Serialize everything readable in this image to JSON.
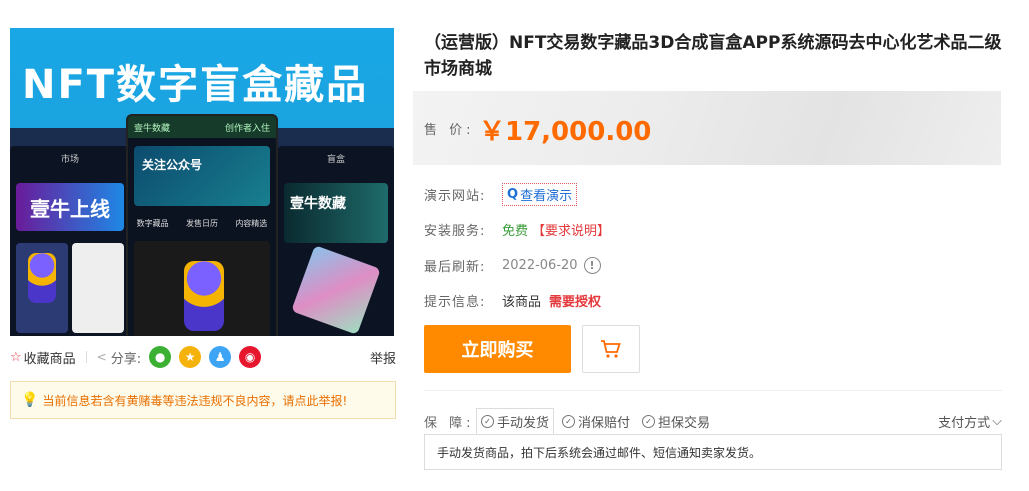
{
  "image": {
    "banner_title": "NFT数字盲盒藏品",
    "left_tab": "市场",
    "left_neon": "壹牛上线",
    "mid_brand": "壹牛数藏",
    "mid_creator": "创作者入住",
    "mid_follow": "关注公众号",
    "mid_tabs": [
      "数字藏品",
      "发售日历",
      "内容精选"
    ],
    "right_tab": "盲盒",
    "right_banner": "壹牛数藏"
  },
  "actions": {
    "favorite_label": "收藏商品",
    "share_label": "分享:",
    "report_label": "举报"
  },
  "notice": {
    "text": "当前信息若含有黄赌毒等违法违规不良内容，请点此举报!"
  },
  "product": {
    "title": "（运营版）NFT交易数字藏品3D合成盲盒APP系统源码去中心化艺术品二级市场商城",
    "price_label": "售 价:",
    "price": "￥17,000.00"
  },
  "info": {
    "demo_label": "演示网站:",
    "demo_link": "查看演示",
    "service_label": "安装服务:",
    "service_value": "免费",
    "service_note": "【要求说明】",
    "refresh_label": "最后刷新:",
    "refresh_value": "2022-06-20",
    "tip_label": "提示信息:",
    "tip_value": "该商品",
    "tip_flag": "需要授权"
  },
  "buttons": {
    "buy": "立即购买"
  },
  "guarantee": {
    "label": "保 障:",
    "items": [
      "手动发货",
      "消保赔付",
      "担保交易"
    ],
    "payment": "支付方式",
    "description": "手动发货商品，拍下后系统会通过邮件、短信通知卖家发货。"
  },
  "colors": {
    "price": "#ff6a00",
    "buy_button": "#ff8a00",
    "link": "#1e6fd6",
    "alert": "#e4393c",
    "free": "#3a9c3a"
  }
}
